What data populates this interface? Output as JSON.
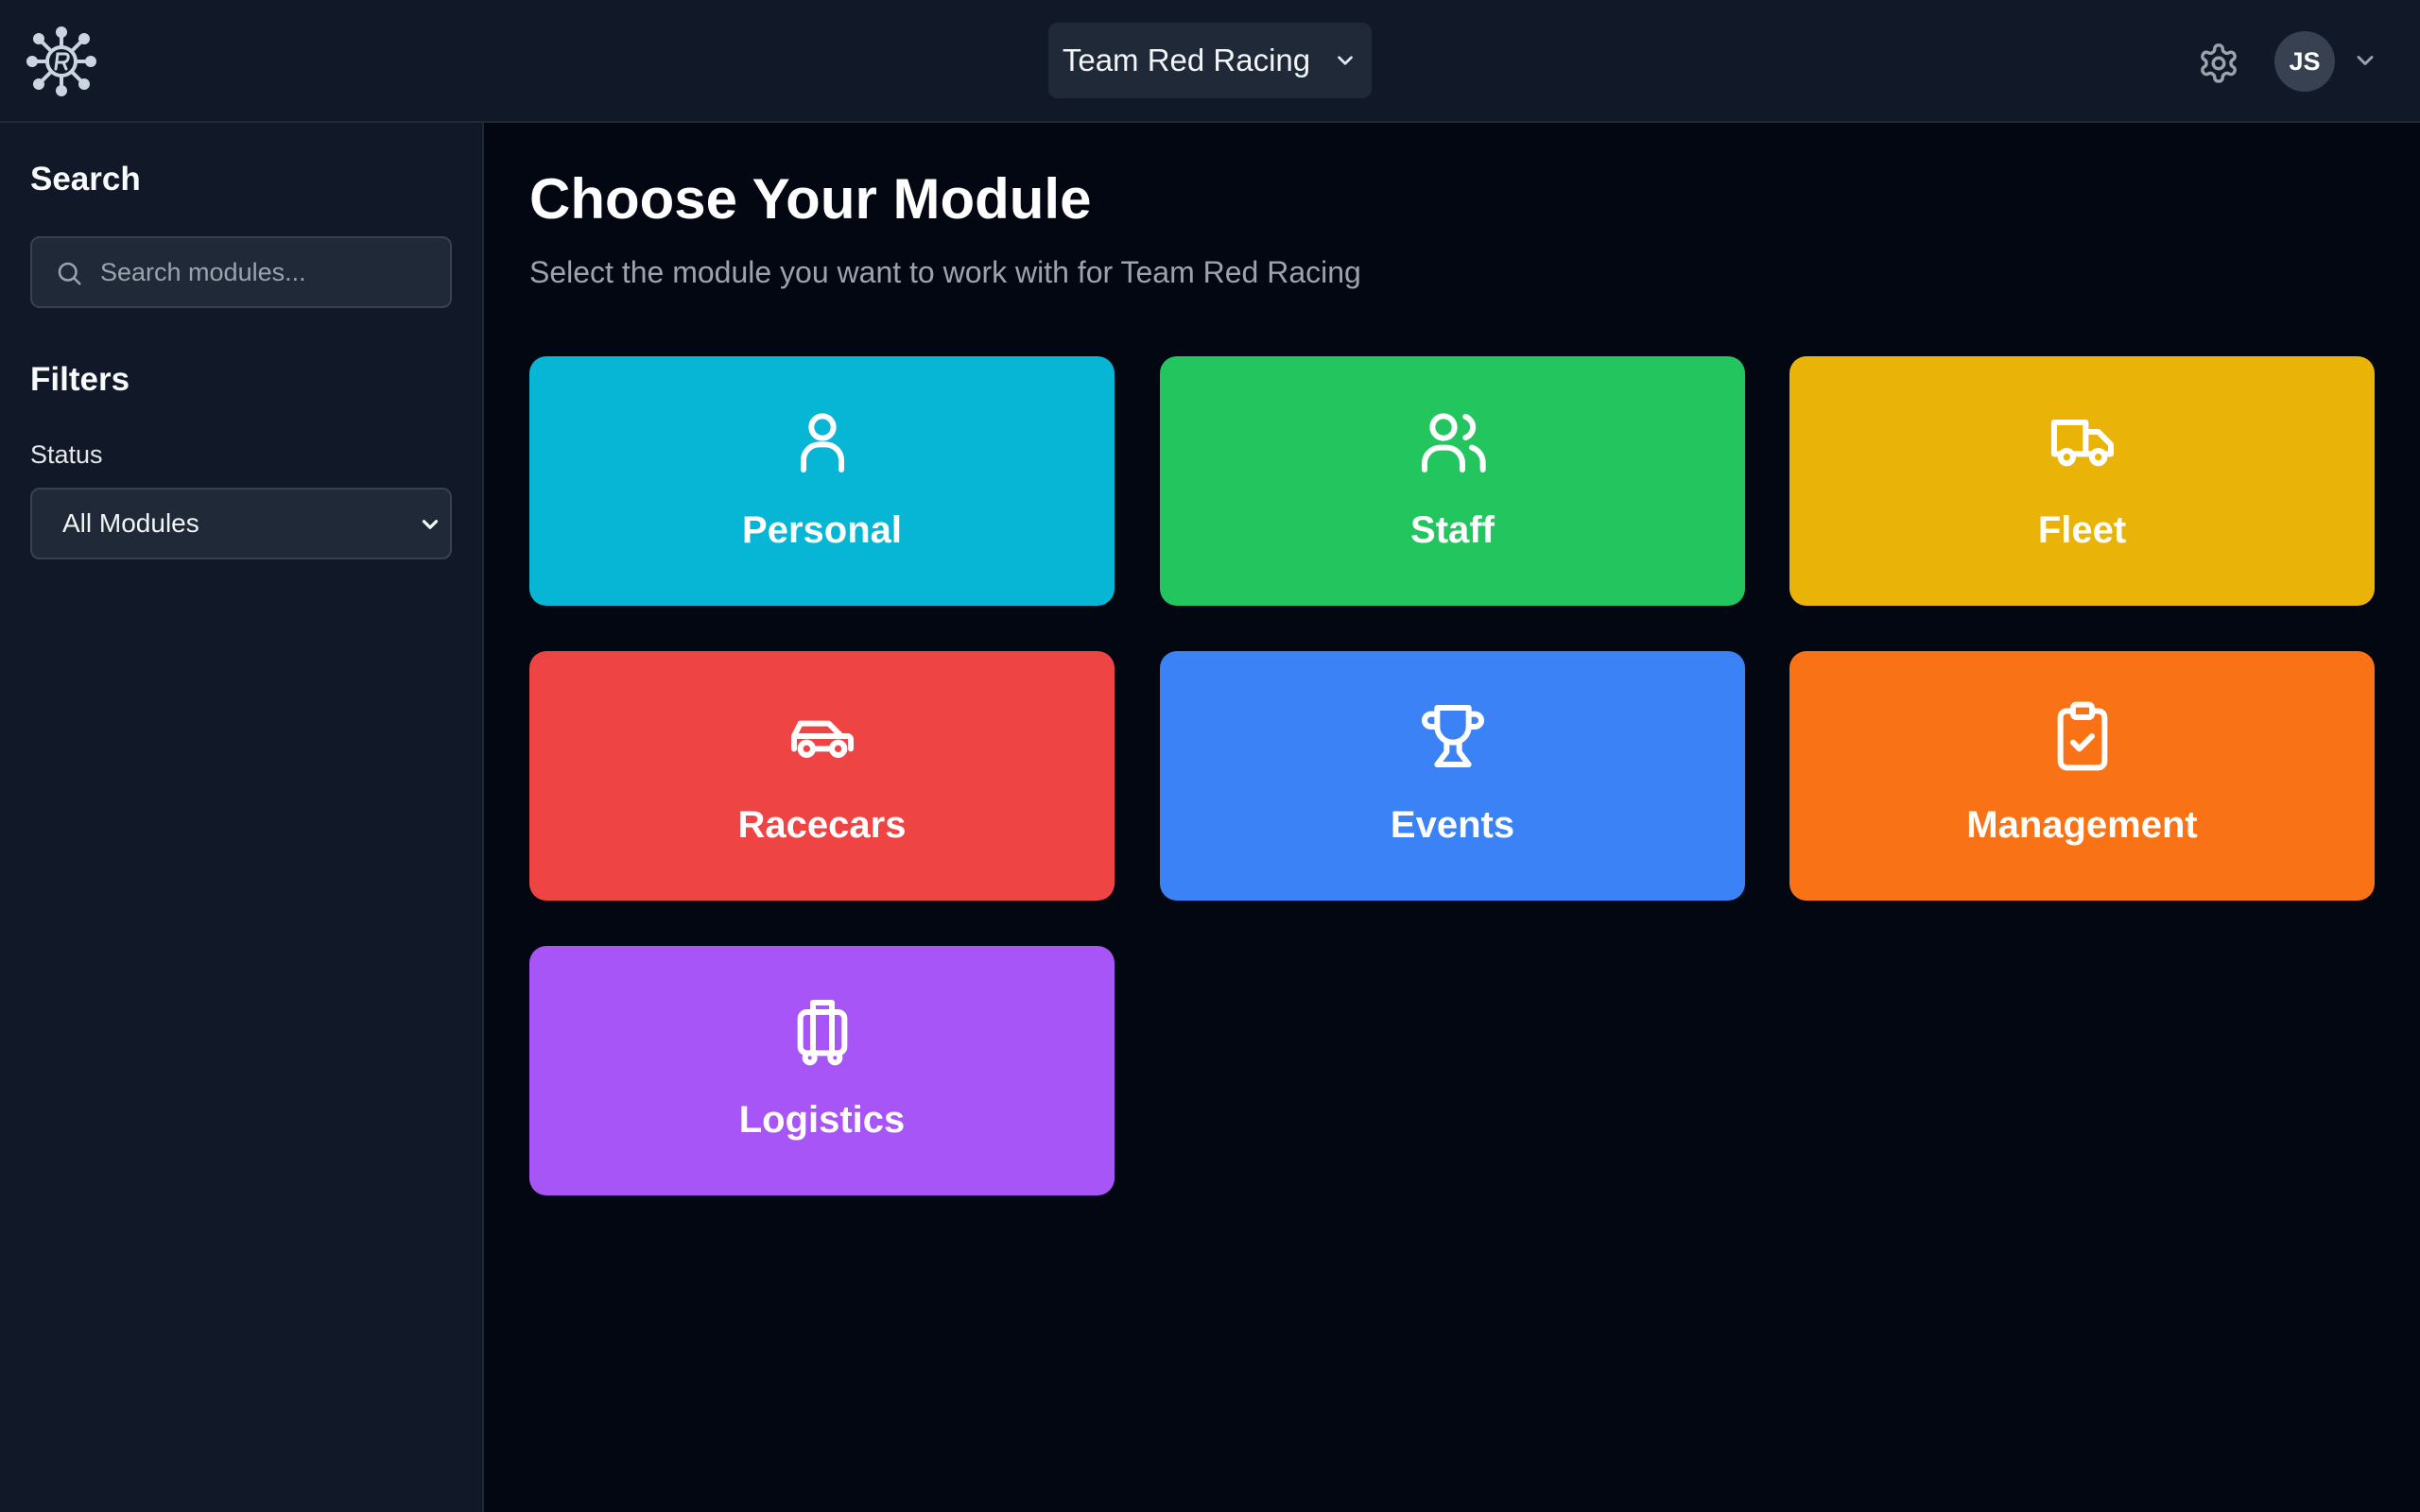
{
  "header": {
    "team_name": "Team Red Racing",
    "avatar_initials": "JS",
    "icons": {
      "logo": "racing-logo-icon",
      "team_caret": "chevron-down-icon",
      "settings": "gear-icon",
      "avatar_caret": "chevron-down-icon"
    }
  },
  "sidebar": {
    "search_heading": "Search",
    "search_placeholder": "Search modules...",
    "search_value": "",
    "filters_heading": "Filters",
    "status_label": "Status",
    "status_selected": "All Modules"
  },
  "main": {
    "title": "Choose Your Module",
    "subtitle": "Select the module you want to work with for Team Red Racing",
    "modules": [
      {
        "name": "Personal",
        "color": "#06b6d4",
        "icon": "user-icon"
      },
      {
        "name": "Staff",
        "color": "#22c55e",
        "icon": "users-icon"
      },
      {
        "name": "Fleet",
        "color": "#eab308",
        "icon": "truck-icon"
      },
      {
        "name": "Racecars",
        "color": "#ef4444",
        "icon": "car-icon"
      },
      {
        "name": "Events",
        "color": "#3b82f6",
        "icon": "trophy-icon"
      },
      {
        "name": "Management",
        "color": "#f97316",
        "icon": "clipboard-check-icon"
      },
      {
        "name": "Logistics",
        "color": "#a855f7",
        "icon": "luggage-icon"
      }
    ]
  },
  "colors": {
    "page_bg": "#030712",
    "panel_bg": "#111827",
    "control_bg": "#1f2937",
    "muted_text": "#9ca3af"
  }
}
